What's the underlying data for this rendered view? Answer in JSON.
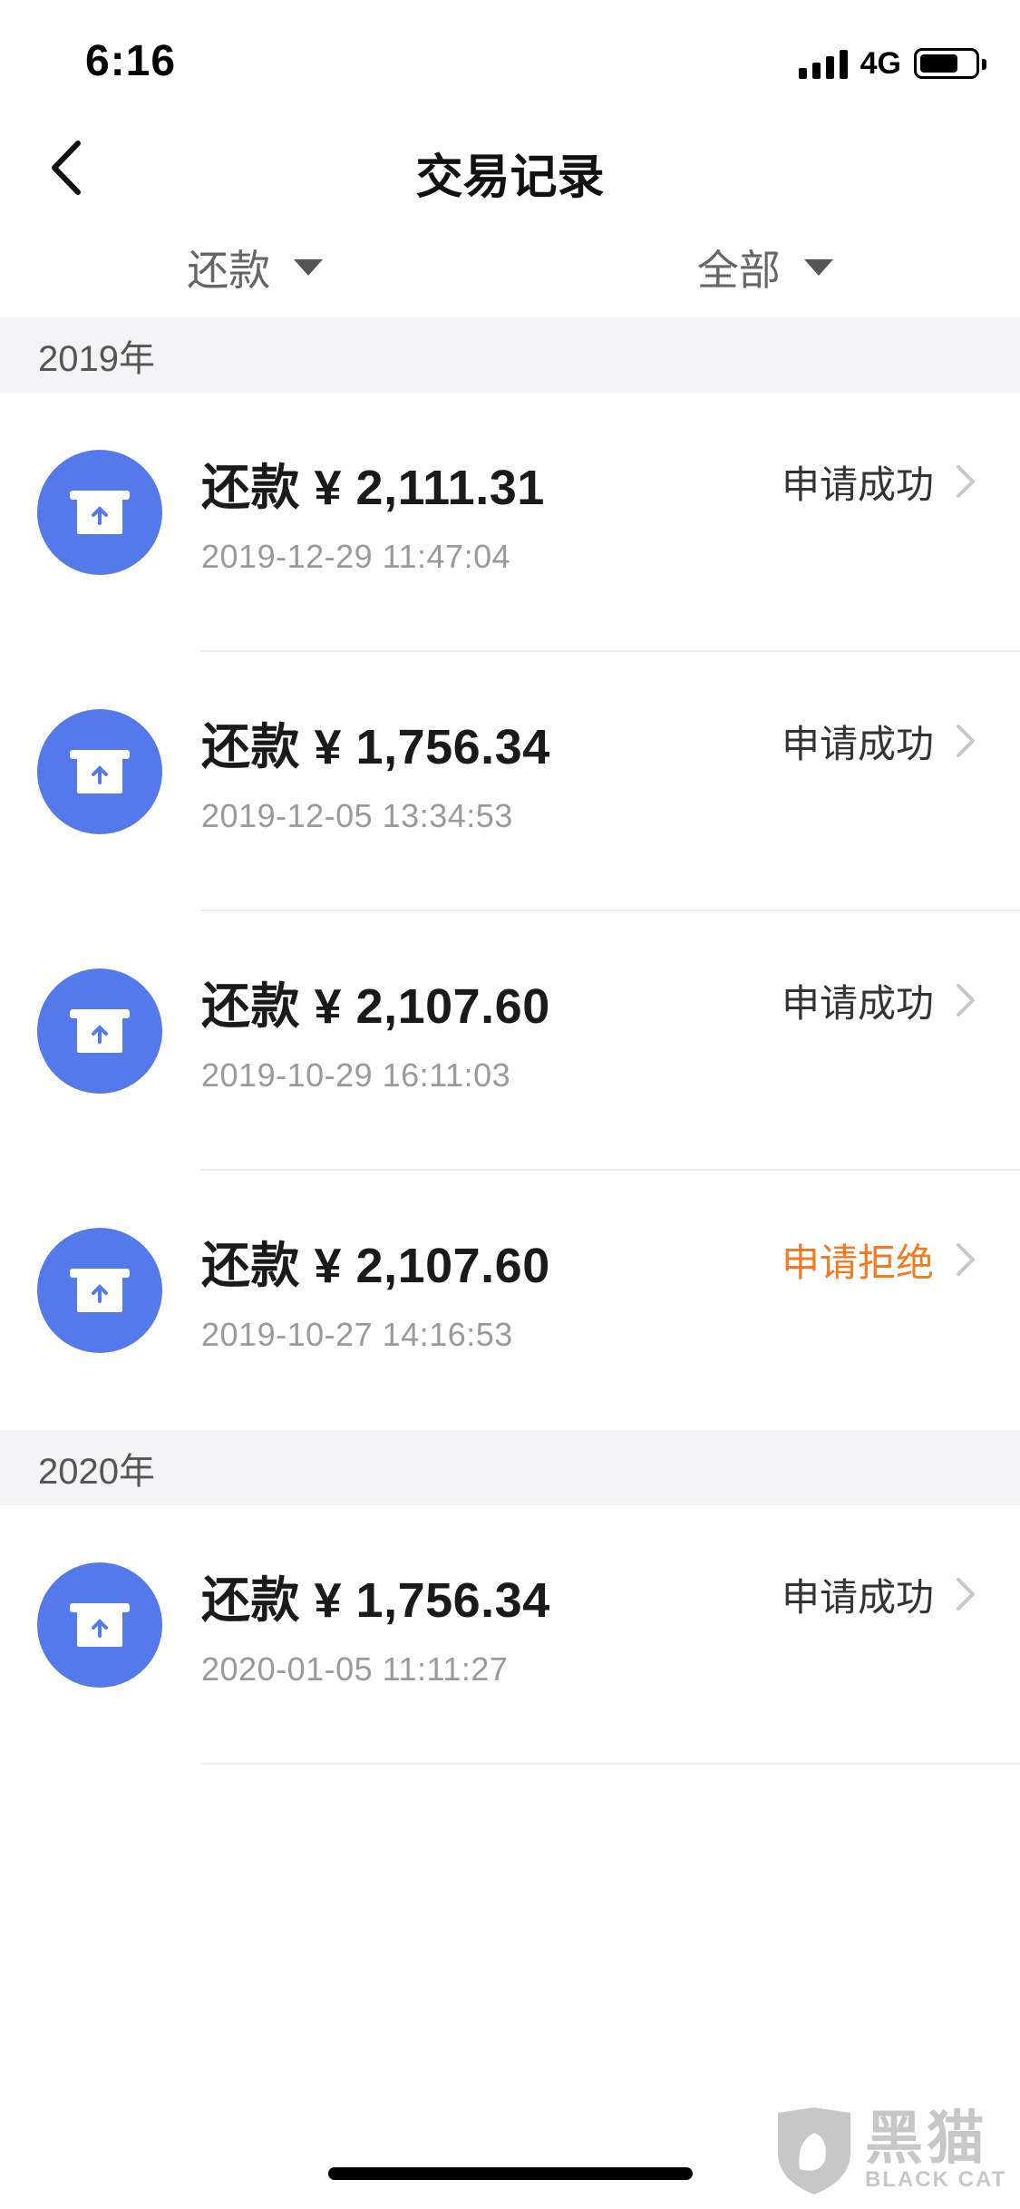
{
  "status_bar": {
    "time": "6:16",
    "network": "4G",
    "battery_level": 0.7
  },
  "nav": {
    "title": "交易记录"
  },
  "filters": [
    {
      "label": "还款"
    },
    {
      "label": "全部"
    }
  ],
  "sections": [
    {
      "year": "2019年",
      "items": [
        {
          "title": "还款 ¥ 2,111.31",
          "time": "2019-12-29 11:47:04",
          "status": "申请成功"
        },
        {
          "title": "还款 ¥ 1,756.34",
          "time": "2019-12-05 13:34:53",
          "status": "申请成功"
        },
        {
          "title": "还款 ¥ 2,107.60",
          "time": "2019-10-29 16:11:03",
          "status": "申请成功"
        },
        {
          "title": "还款 ¥ 2,107.60",
          "time": "2019-10-27 14:16:53",
          "status": "申请拒绝"
        }
      ]
    },
    {
      "year": "2020年",
      "items": [
        {
          "title": "还款 ¥ 1,756.34",
          "time": "2020-01-05 11:11:27",
          "status": "申请成功"
        }
      ]
    }
  ],
  "colors": {
    "icon_bg": "#5479ea",
    "rejected": "#f37a21",
    "section_bg": "#f3f4f6"
  },
  "watermark": {
    "cn": "黑猫",
    "en": "BLACK CAT"
  }
}
